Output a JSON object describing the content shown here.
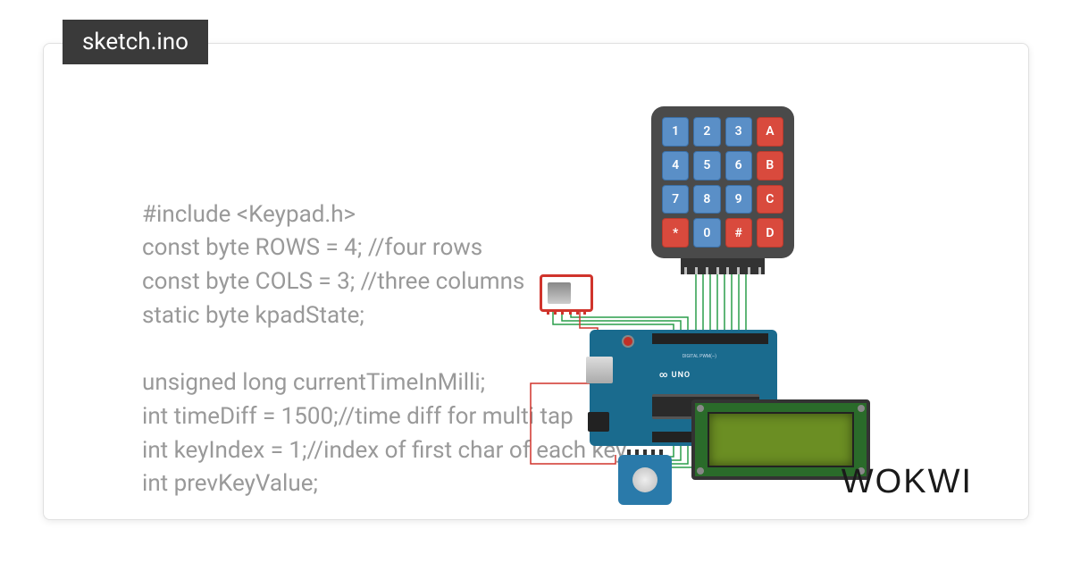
{
  "tab": {
    "filename": "sketch.ino"
  },
  "code": {
    "line1": "#include <Keypad.h>",
    "line2": "const byte ROWS = 4; //four rows",
    "line3": "const byte COLS = 3; //three columns",
    "line4": "static byte kpadState;",
    "line5": "",
    "line6": "unsigned long currentTimeInMilli;",
    "line7": "int timeDiff = 1500;//time diff for multi tap",
    "line8": "int keyIndex = 1;//index of first char of each key",
    "line9": "int prevKeyValue;"
  },
  "keypad": {
    "keys": [
      {
        "label": "1",
        "red": false
      },
      {
        "label": "2",
        "red": false
      },
      {
        "label": "3",
        "red": false
      },
      {
        "label": "A",
        "red": true
      },
      {
        "label": "4",
        "red": false
      },
      {
        "label": "5",
        "red": false
      },
      {
        "label": "6",
        "red": false
      },
      {
        "label": "B",
        "red": true
      },
      {
        "label": "7",
        "red": false
      },
      {
        "label": "8",
        "red": false
      },
      {
        "label": "9",
        "red": false
      },
      {
        "label": "C",
        "red": true
      },
      {
        "label": "*",
        "red": true
      },
      {
        "label": "0",
        "red": false
      },
      {
        "label": "#",
        "red": true
      },
      {
        "label": "D",
        "red": true
      }
    ]
  },
  "arduino": {
    "label": "UNO",
    "brand_symbol": "∞",
    "header_text": "DIGITAL PWM(~)"
  },
  "components": {
    "sdcard": "microsd-module",
    "rtc": "rtc-module",
    "lcd": "lcd-2004-display"
  },
  "brand": "WOKWI"
}
